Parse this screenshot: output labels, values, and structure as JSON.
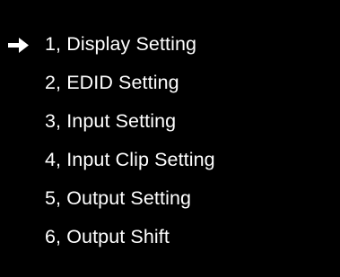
{
  "colors": {
    "background": "#000000",
    "text": "#ffffff",
    "cursor": "#ffffff"
  },
  "menu": {
    "cursor_icon": "right-arrow-icon",
    "selected_index": 0,
    "items": [
      {
        "label": "1, Display Setting"
      },
      {
        "label": "2, EDID Setting"
      },
      {
        "label": "3, Input Setting"
      },
      {
        "label": "4, Input Clip Setting"
      },
      {
        "label": "5, Output Setting"
      },
      {
        "label": "6, Output Shift"
      }
    ]
  }
}
